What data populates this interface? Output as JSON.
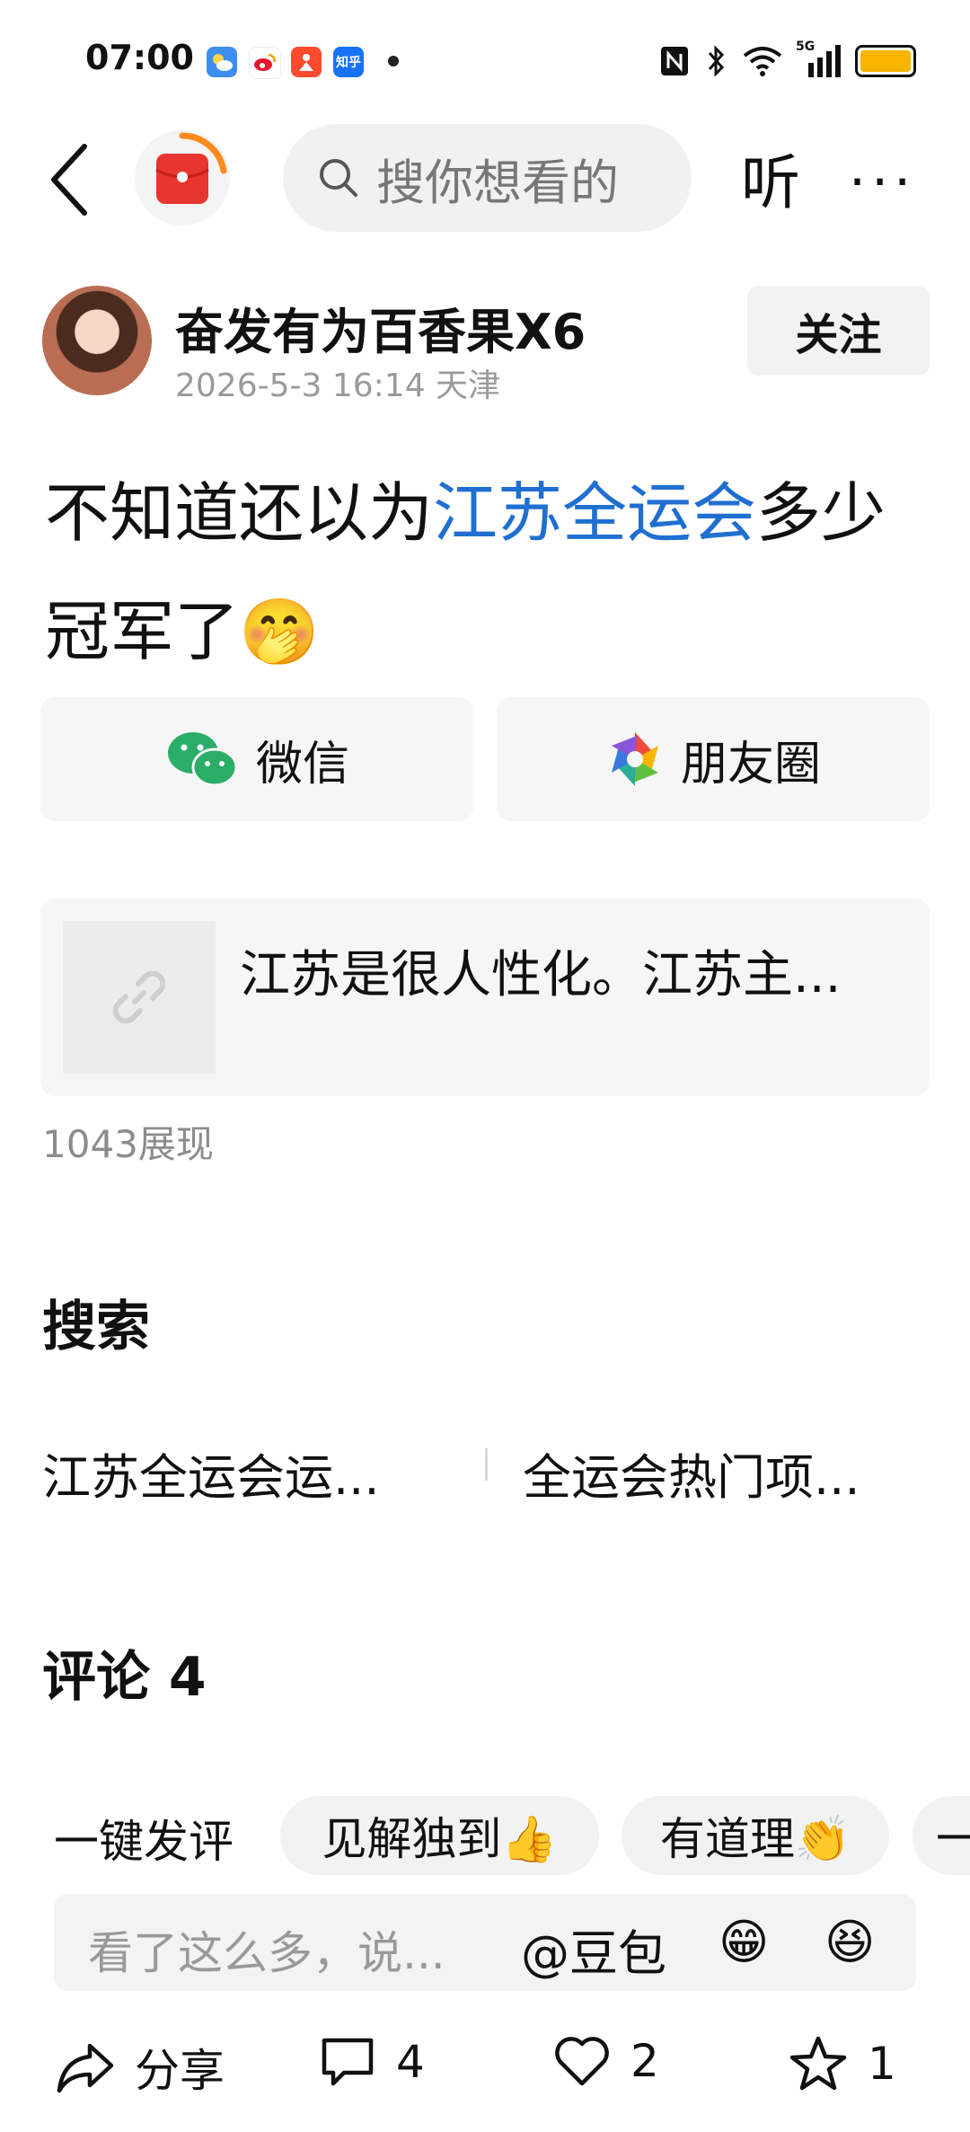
{
  "status_bar": {
    "time": "07:00",
    "apps": [
      "weather-app",
      "weibo-app",
      "xiaohongshu-app",
      "知乎"
    ],
    "network": "5G"
  },
  "header": {
    "search_placeholder": "搜你想看的",
    "listen_label": "听",
    "more_label": "···"
  },
  "author": {
    "name": "奋发有为百香果X6",
    "meta": "2026-5-3 16:14 天津",
    "follow_label": "关注"
  },
  "post": {
    "text_prefix": "不知道还以为",
    "topic_link": "江苏全运会",
    "text_suffix": "多少冠军了",
    "emoji": "🤭"
  },
  "share": {
    "wechat_label": "微信",
    "moments_label": "朋友圈"
  },
  "link_card": {
    "title": "江苏是很人性化。江苏主..."
  },
  "views": "1043展现",
  "search_section": {
    "title": "搜索",
    "suggestions": [
      "江苏全运会运...",
      "全运会热门项..."
    ]
  },
  "comments": {
    "title": "评论 4",
    "quick_label": "一键发评",
    "chips": [
      "见解独到👍",
      "有道理👏",
      "一"
    ],
    "input_placeholder": "看了这么多，说...",
    "at_label": "@豆包",
    "emojis": [
      "😁",
      "😆"
    ]
  },
  "bottom_bar": {
    "share_label": "分享",
    "comment_count": "4",
    "like_count": "2",
    "favorite_count": "1"
  },
  "colors": {
    "link_blue": "#1f6fd1",
    "wechat_green": "#2aae67",
    "battery_yellow": "#f7b500"
  }
}
